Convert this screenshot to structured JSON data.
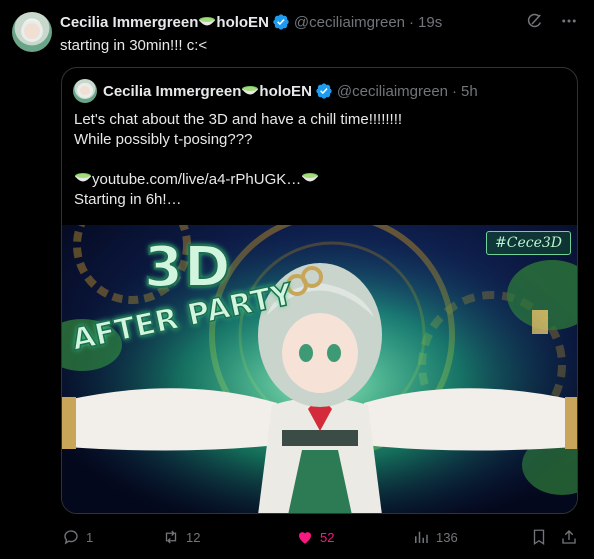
{
  "tweet": {
    "author_name": "Cecilia Immergreen",
    "author_suffix": "holoEN",
    "handle": "@ceciliaimgreen",
    "time": "19s",
    "text": "starting in 30min!!! c:<"
  },
  "quoted": {
    "author_name": "Cecilia Immergreen",
    "author_suffix": "holoEN",
    "handle": "@ceciliaimgreen",
    "time": "5h",
    "lines": [
      "Let's chat about the 3D and have a chill time!!!!!!!!",
      "While possibly t-posing???",
      "",
      "youtube.com/live/a4-rPhUGK…",
      "Starting in 6h!…"
    ],
    "media": {
      "hashtag": "#Cece3D",
      "title_big": "3D",
      "title_small": "AFTER PARTY"
    }
  },
  "actions": {
    "replies": "1",
    "reposts": "12",
    "likes": "52",
    "views": "136"
  },
  "colors": {
    "text": "#e7e9ea",
    "muted": "#71767b",
    "verified": "#1d9bf0",
    "like": "#f91880",
    "border": "#2f3336"
  },
  "icons": [
    "grok-icon",
    "more-icon",
    "verified-badge-icon",
    "matcha-bowl-icon",
    "reply-icon",
    "repost-icon",
    "heart-icon",
    "views-icon",
    "bookmark-icon",
    "share-icon"
  ]
}
